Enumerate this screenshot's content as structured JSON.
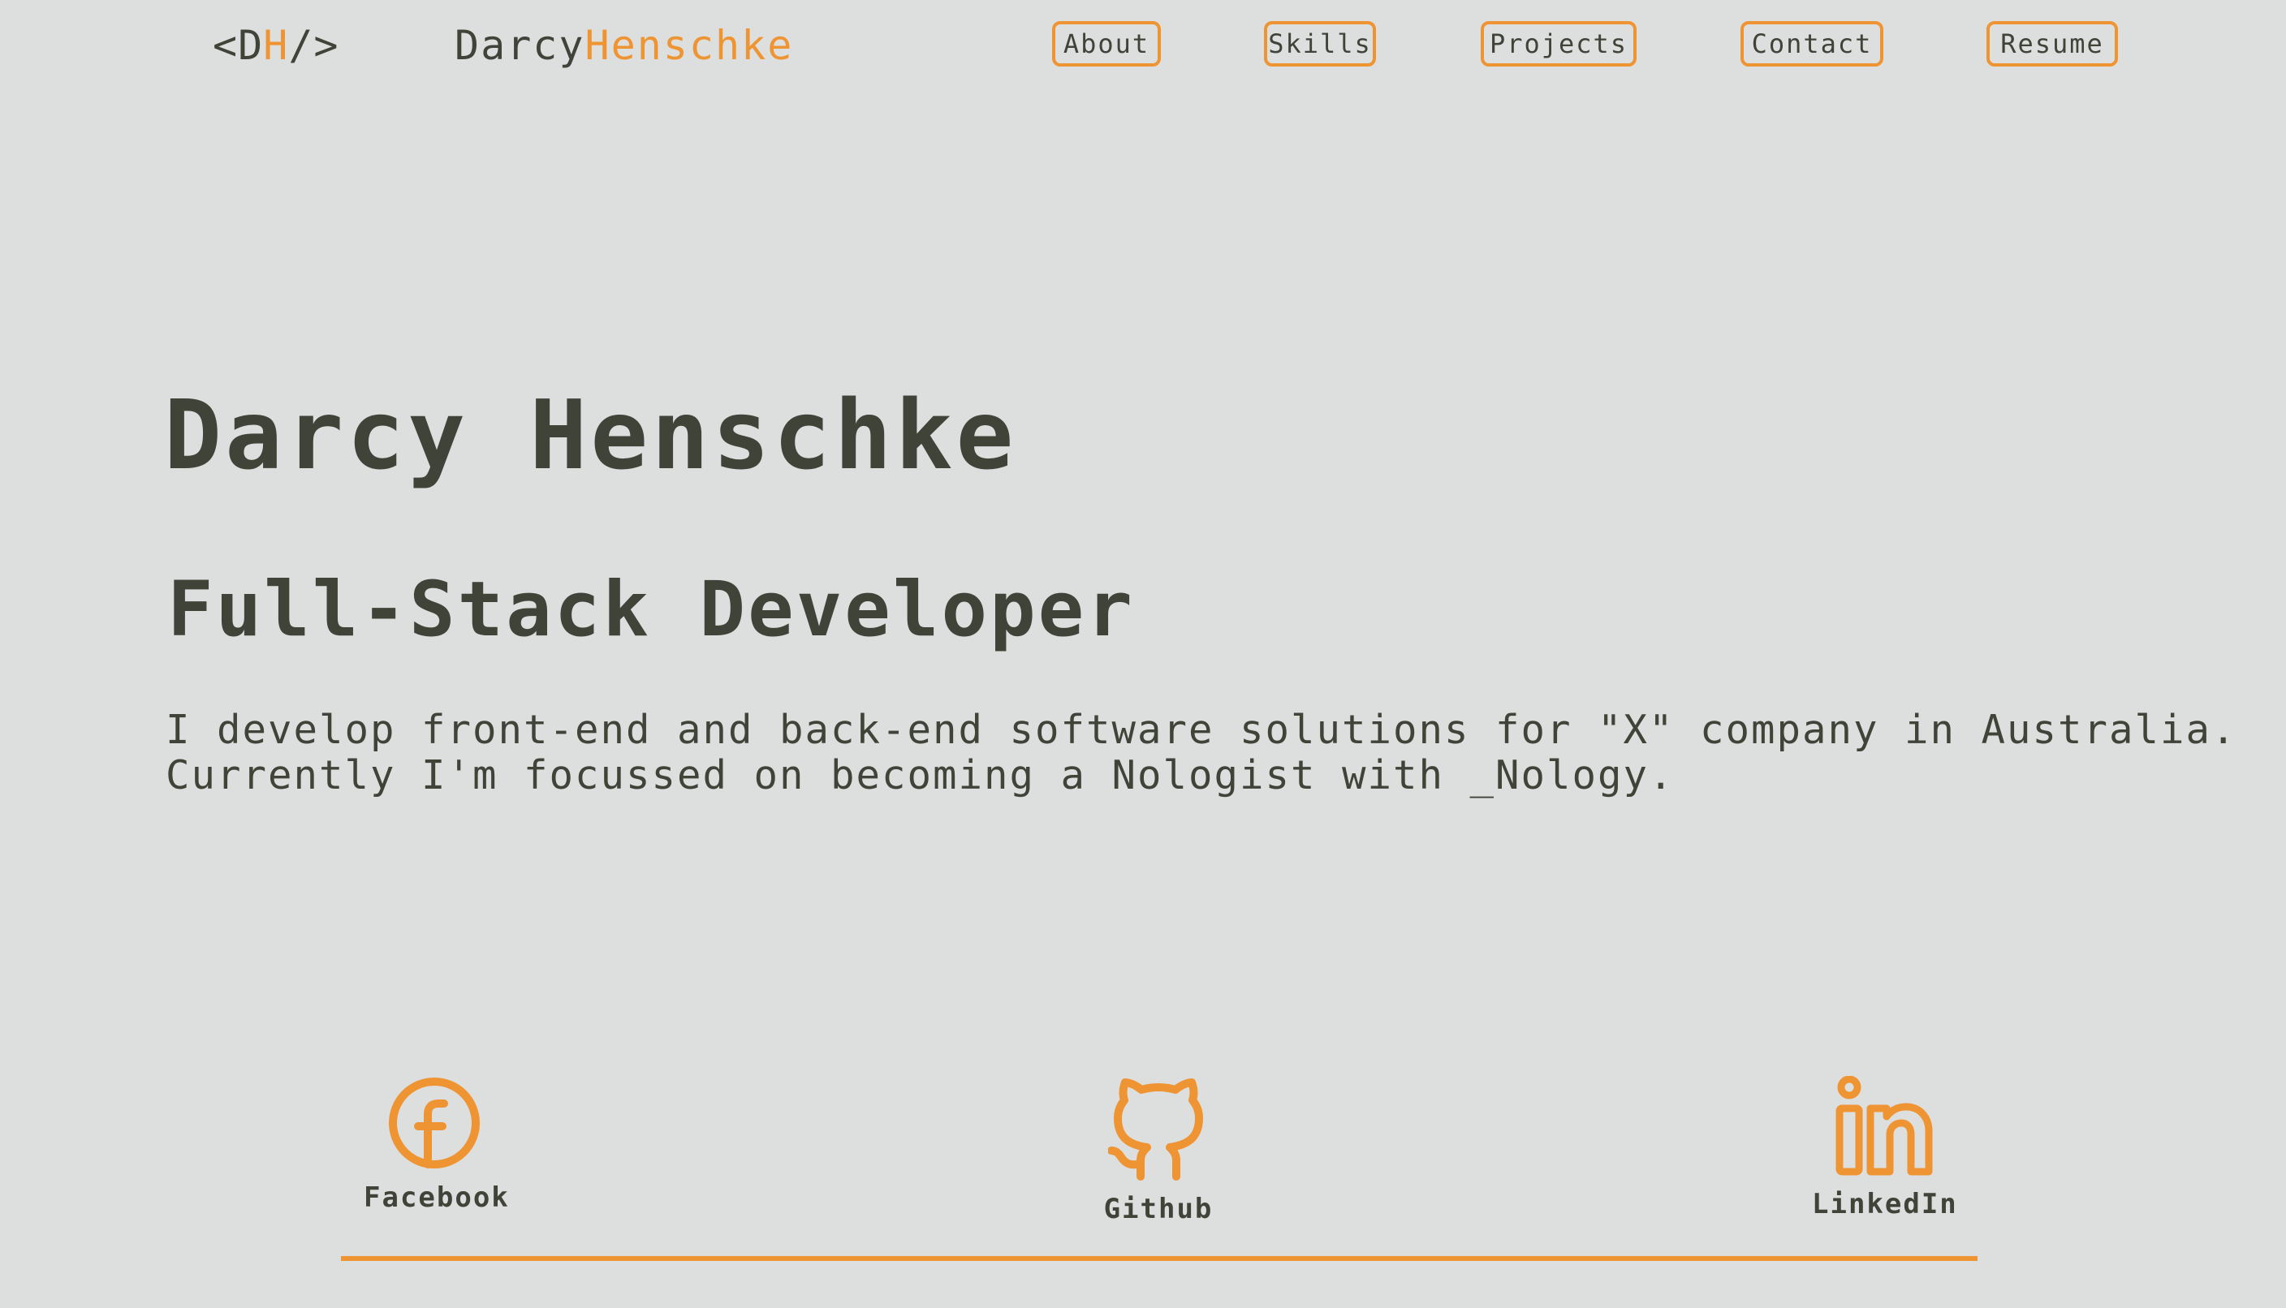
{
  "header": {
    "logo": {
      "open": "<D",
      "accent": "H",
      "close": "/>"
    },
    "brand": {
      "first": "Darcy",
      "last": "Henschke"
    },
    "nav": [
      {
        "label": "About"
      },
      {
        "label": "Skills"
      },
      {
        "label": "Projects"
      },
      {
        "label": "Contact"
      },
      {
        "label": "Resume"
      }
    ]
  },
  "hero": {
    "name": "Darcy Henschke",
    "title": "Full-Stack Developer",
    "description_line1": "I develop front-end and back-end software solutions for \"X\" company in Australia.",
    "description_line2": "Currently I'm focussed on becoming a Nologist with _Nology."
  },
  "socials": [
    {
      "label": "Facebook",
      "icon": "facebook-icon"
    },
    {
      "label": "Github",
      "icon": "github-icon"
    },
    {
      "label": "LinkedIn",
      "icon": "linkedin-icon"
    }
  ],
  "colors": {
    "accent": "#ef9433",
    "text": "#3f4338",
    "background": "#dddfdf"
  }
}
